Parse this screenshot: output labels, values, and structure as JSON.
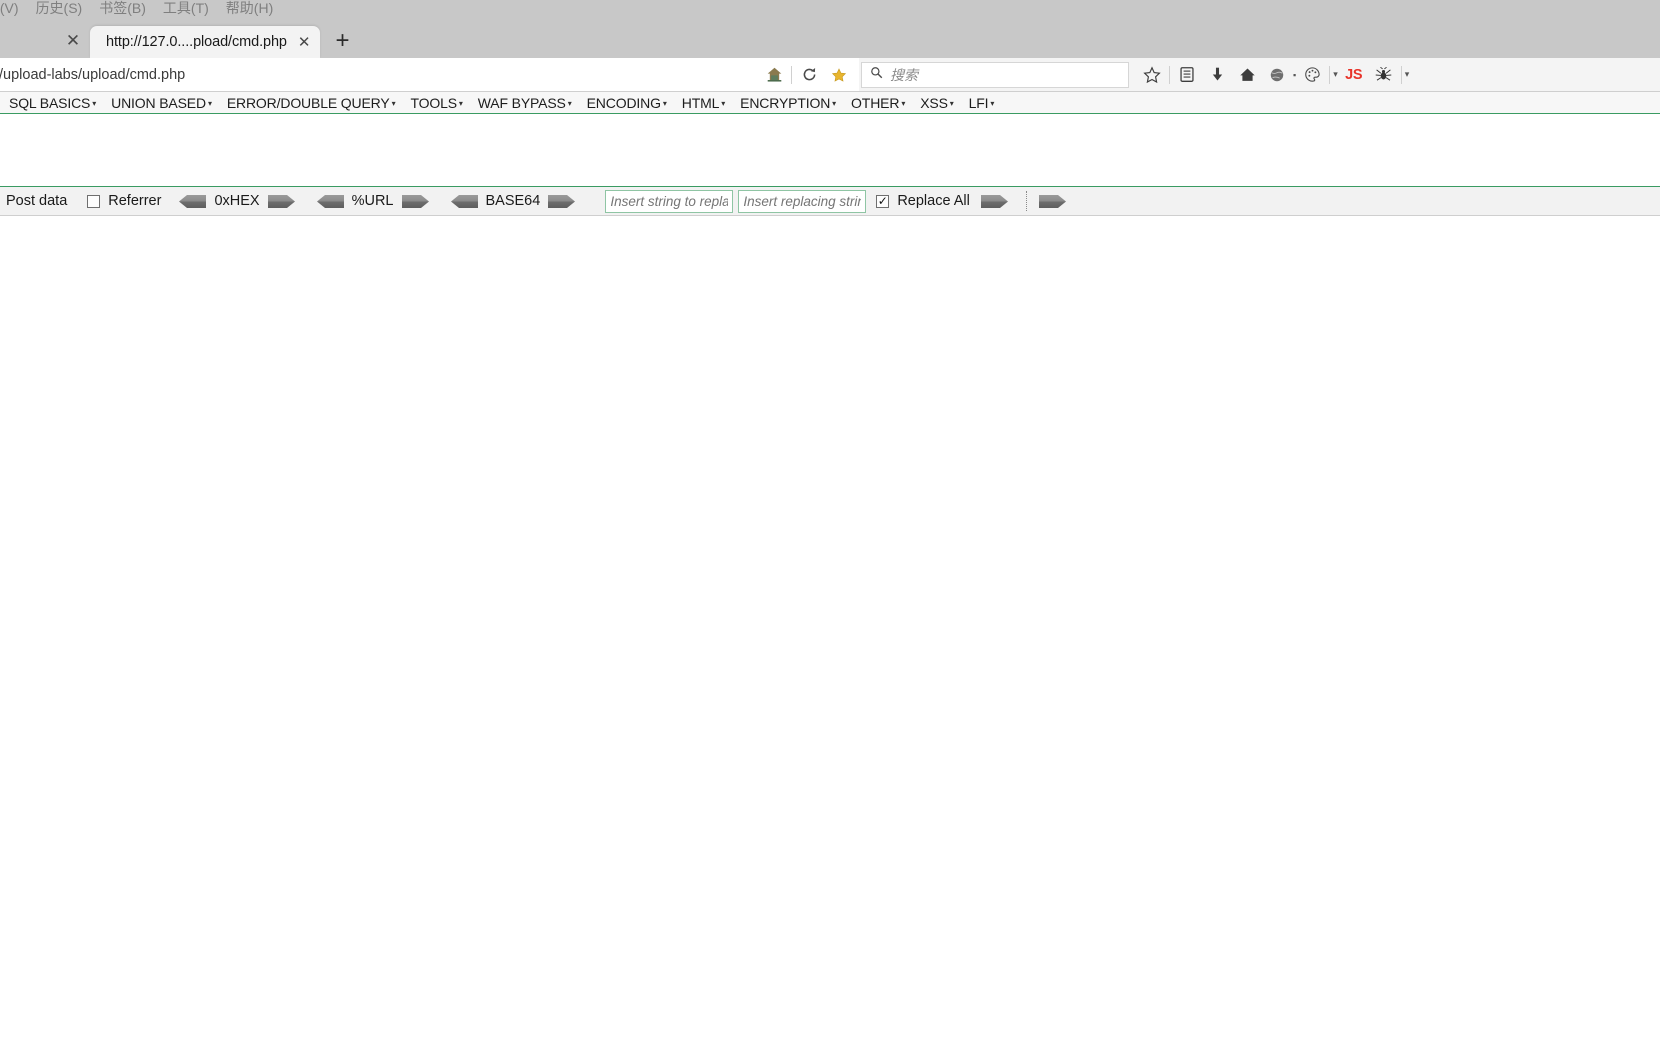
{
  "browser": {
    "menubar": {
      "items": [
        {
          "label": " (V)",
          "name": "menu-view"
        },
        {
          "label": "历史(S)",
          "name": "menu-history"
        },
        {
          "label": "书签(B)",
          "name": "menu-bookmarks"
        },
        {
          "label": "工具(T)",
          "name": "menu-tools"
        },
        {
          "label": "帮助(H)",
          "name": "menu-help"
        }
      ]
    },
    "tabs": [
      {
        "title": "http://127.0....pload/cmd.php",
        "active": true
      }
    ],
    "new_tab_label": "+",
    "tab_close_label": "✕",
    "urlbar": {
      "value": "/upload-labs/upload/cmd.php",
      "icons": [
        "home-icon",
        "reload-icon",
        "bookmark-star-icon"
      ]
    },
    "search": {
      "placeholder": "搜索",
      "icon": "search-icon"
    },
    "toolbar_icons": [
      {
        "name": "bookmark-star-icon",
        "glyph": "☆"
      },
      {
        "name": "library-icon",
        "glyph": "Ὄb"
      },
      {
        "name": "download-icon",
        "glyph": "↓"
      },
      {
        "name": "home-icon",
        "glyph": "⌂"
      },
      {
        "name": "globe-icon",
        "glyph": "●"
      },
      {
        "name": "palette-icon",
        "glyph": "◌"
      },
      {
        "name": "overflow-caret-icon",
        "glyph": "▾"
      },
      {
        "name": "js-toggle-icon",
        "glyph": "JS"
      },
      {
        "name": "bug-icon",
        "glyph": "✱"
      },
      {
        "name": "extensions-caret-icon",
        "glyph": "▾"
      }
    ],
    "bookmarks": [
      {
        "label": "SQL BASICS",
        "has_menu": true
      },
      {
        "label": "UNION BASED",
        "has_menu": true
      },
      {
        "label": "ERROR/DOUBLE QUERY",
        "has_menu": true
      },
      {
        "label": "TOOLS",
        "has_menu": true
      },
      {
        "label": "WAF BYPASS",
        "has_menu": true
      },
      {
        "label": "ENCODING",
        "has_menu": true
      },
      {
        "label": "HTML",
        "has_menu": true
      },
      {
        "label": "ENCRYPTION",
        "has_menu": true
      },
      {
        "label": "OTHER",
        "has_menu": true
      },
      {
        "label": "XSS",
        "has_menu": true
      },
      {
        "label": "LFI",
        "has_menu": true
      }
    ]
  },
  "hackbar": {
    "post_data_label": "Post data",
    "referrer": {
      "label": "Referrer",
      "checked": false
    },
    "encoders": [
      {
        "label": "0xHEX",
        "decode": "decode-arrow",
        "encode": "encode-arrow"
      },
      {
        "label": "%URL",
        "decode": "decode-arrow",
        "encode": "encode-arrow"
      },
      {
        "label": "BASE64",
        "decode": "decode-arrow",
        "encode": "encode-arrow"
      }
    ],
    "search_input": {
      "placeholder": "Insert string to replace",
      "value": ""
    },
    "replace_input": {
      "placeholder": "Insert replacing string",
      "value": ""
    },
    "replace_all": {
      "label": "Replace All",
      "checked": true
    },
    "replace_run_arrow": "replace-arrow",
    "extra_arrow": "extra-arrow"
  },
  "page": {
    "content": ""
  },
  "colors": {
    "accent_green": "#3a9b62",
    "chrome_gray": "#c8c8c8",
    "toolbar_gray": "#f2f2f2",
    "js_red": "#e8342a",
    "input_border_green": "#8fc5a4"
  }
}
